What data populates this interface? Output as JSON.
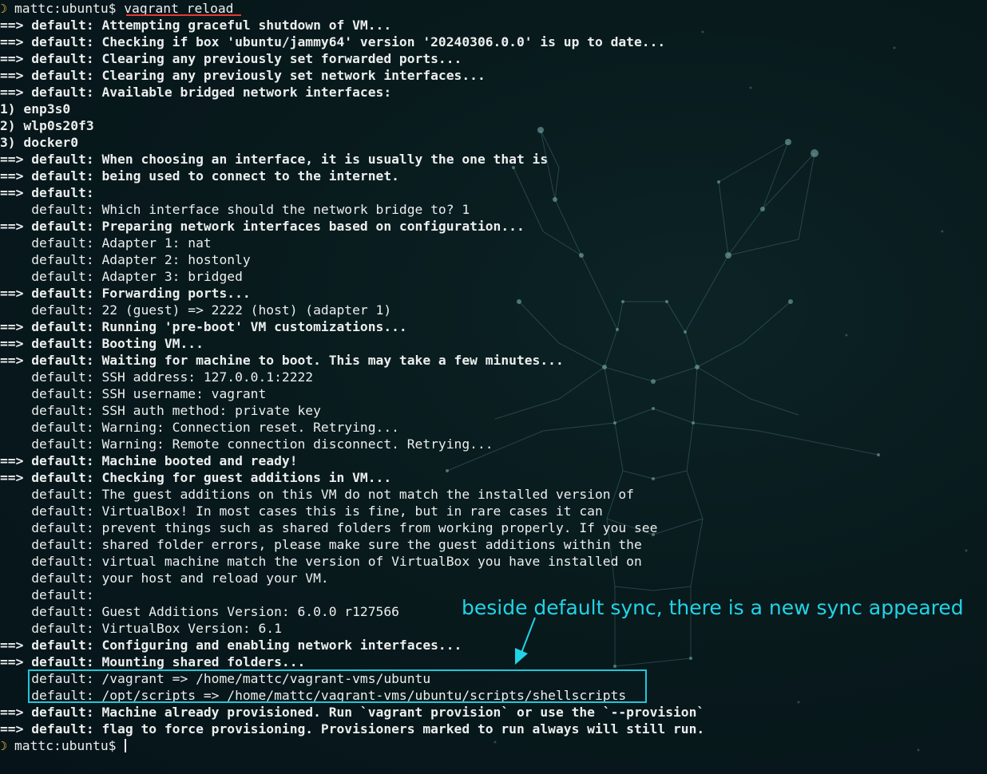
{
  "prompt": {
    "icon": "crescent-moon-icon",
    "user_host": "mattc:ubuntu$",
    "command": "vagrant reload"
  },
  "lines": [
    {
      "prefix": "==> ",
      "text": "default: Attempting graceful shutdown of VM..."
    },
    {
      "prefix": "==> ",
      "text": "default: Checking if box 'ubuntu/jammy64' version '20240306.0.0' is up to date..."
    },
    {
      "prefix": "==> ",
      "text": "default: Clearing any previously set forwarded ports..."
    },
    {
      "prefix": "==> ",
      "text": "default: Clearing any previously set network interfaces..."
    },
    {
      "prefix": "==> ",
      "text": "default: Available bridged network interfaces:"
    },
    {
      "prefix": "",
      "text": "1) enp3s0"
    },
    {
      "prefix": "",
      "text": "2) wlp0s20f3"
    },
    {
      "prefix": "",
      "text": "3) docker0"
    },
    {
      "prefix": "==> ",
      "text": "default: When choosing an interface, it is usually the one that is"
    },
    {
      "prefix": "==> ",
      "text": "default: being used to connect to the internet."
    },
    {
      "prefix": "==> ",
      "text": "default:"
    },
    {
      "prefix": "    ",
      "text": "default: Which interface should the network bridge to? 1"
    },
    {
      "prefix": "==> ",
      "text": "default: Preparing network interfaces based on configuration..."
    },
    {
      "prefix": "    ",
      "text": "default: Adapter 1: nat"
    },
    {
      "prefix": "    ",
      "text": "default: Adapter 2: hostonly"
    },
    {
      "prefix": "    ",
      "text": "default: Adapter 3: bridged"
    },
    {
      "prefix": "==> ",
      "text": "default: Forwarding ports..."
    },
    {
      "prefix": "    ",
      "text": "default: 22 (guest) => 2222 (host) (adapter 1)"
    },
    {
      "prefix": "==> ",
      "text": "default: Running 'pre-boot' VM customizations..."
    },
    {
      "prefix": "==> ",
      "text": "default: Booting VM..."
    },
    {
      "prefix": "==> ",
      "text": "default: Waiting for machine to boot. This may take a few minutes..."
    },
    {
      "prefix": "    ",
      "text": "default: SSH address: 127.0.0.1:2222"
    },
    {
      "prefix": "    ",
      "text": "default: SSH username: vagrant"
    },
    {
      "prefix": "    ",
      "text": "default: SSH auth method: private key"
    },
    {
      "prefix": "    ",
      "text": "default: Warning: Connection reset. Retrying..."
    },
    {
      "prefix": "    ",
      "text": "default: Warning: Remote connection disconnect. Retrying..."
    },
    {
      "prefix": "==> ",
      "text": "default: Machine booted and ready!"
    },
    {
      "prefix": "==> ",
      "text": "default: Checking for guest additions in VM..."
    },
    {
      "prefix": "    ",
      "text": "default: The guest additions on this VM do not match the installed version of"
    },
    {
      "prefix": "    ",
      "text": "default: VirtualBox! In most cases this is fine, but in rare cases it can"
    },
    {
      "prefix": "    ",
      "text": "default: prevent things such as shared folders from working properly. If you see"
    },
    {
      "prefix": "    ",
      "text": "default: shared folder errors, please make sure the guest additions within the"
    },
    {
      "prefix": "    ",
      "text": "default: virtual machine match the version of VirtualBox you have installed on"
    },
    {
      "prefix": "    ",
      "text": "default: your host and reload your VM."
    },
    {
      "prefix": "    ",
      "text": "default:"
    },
    {
      "prefix": "    ",
      "text": "default: Guest Additions Version: 6.0.0 r127566"
    },
    {
      "prefix": "    ",
      "text": "default: VirtualBox Version: 6.1"
    },
    {
      "prefix": "==> ",
      "text": "default: Configuring and enabling network interfaces..."
    },
    {
      "prefix": "==> ",
      "text": "default: Mounting shared folders..."
    },
    {
      "prefix": "    ",
      "text": "default: /vagrant => /home/mattc/vagrant-vms/ubuntu"
    },
    {
      "prefix": "    ",
      "text": "default: /opt/scripts => /home/mattc/vagrant-vms/ubuntu/scripts/shellscripts"
    },
    {
      "prefix": "==> ",
      "text": "default: Machine already provisioned. Run `vagrant provision` or use the `--provision`"
    },
    {
      "prefix": "==> ",
      "text": "default: flag to force provisioning. Provisioners marked to run always will still run."
    }
  ],
  "final_prompt": {
    "icon": "crescent-moon-icon",
    "user_host": "mattc:ubuntu$"
  },
  "annotation": {
    "text": "beside default sync, there is a new sync appeared",
    "color": "#22d3e6"
  },
  "colors": {
    "background": "#081a1c",
    "text": "#eceeee",
    "prompt_icon": "#f0c23a",
    "command_underline": "#e53935",
    "highlight_box": "#21c6d8"
  }
}
